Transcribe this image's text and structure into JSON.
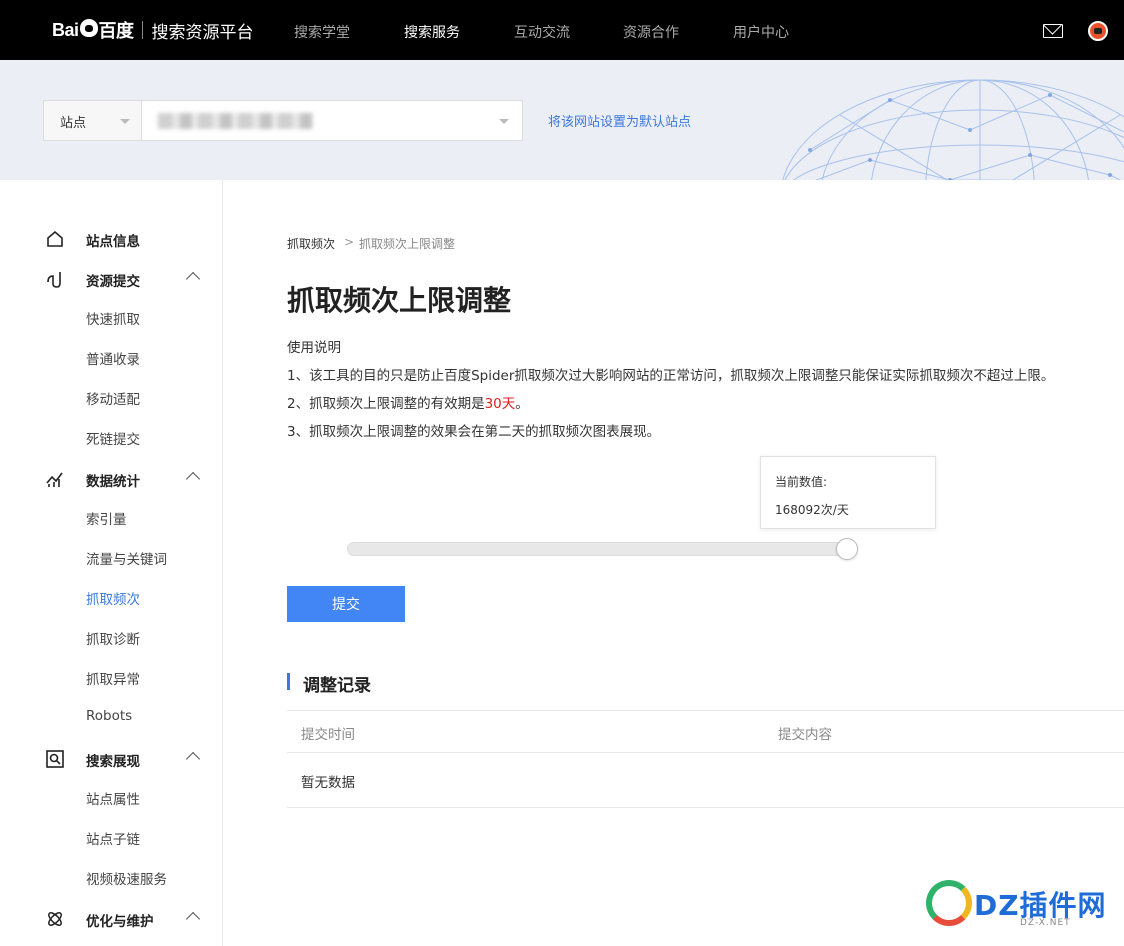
{
  "topbar": {
    "logo_brand": "Bai",
    "logo_du": "百度",
    "platform": "搜索资源平台",
    "nav": [
      {
        "label": "搜索学堂",
        "active": false
      },
      {
        "label": "搜索服务",
        "active": true
      },
      {
        "label": "互动交流",
        "active": false
      },
      {
        "label": "资源合作",
        "active": false
      },
      {
        "label": "用户中心",
        "active": false
      }
    ],
    "icons": [
      "mail-icon",
      "avatar"
    ]
  },
  "site_bar": {
    "label": "站点",
    "set_default_link": "将该网站设置为默认站点"
  },
  "sidebar": {
    "sections": [
      {
        "label": "站点信息",
        "icon": "home-icon",
        "items": []
      },
      {
        "label": "资源提交",
        "icon": "submit-icon",
        "items": [
          "快速抓取",
          "普通收录",
          "移动适配",
          "死链提交"
        ]
      },
      {
        "label": "数据统计",
        "icon": "stats-icon",
        "items": [
          "索引量",
          "流量与关键词",
          "抓取频次",
          "抓取诊断",
          "抓取异常",
          "Robots"
        ]
      },
      {
        "label": "搜索展现",
        "icon": "search-display-icon",
        "items": [
          "站点属性",
          "站点子链",
          "视频极速服务"
        ]
      },
      {
        "label": "优化与维护",
        "icon": "optimize-icon",
        "items": []
      }
    ],
    "active_item": "抓取频次"
  },
  "breadcrumb": {
    "parent": "抓取频次",
    "separator": ">",
    "current": "抓取频次上限调整"
  },
  "main": {
    "title": "抓取频次上限调整",
    "usage_heading": "使用说明",
    "desc1": "1、该工具的目的只是防止百度Spider抓取频次过大影响网站的正常访问，抓取频次上限调整只能保证实际抓取频次不超过上限。",
    "desc2_prefix": "2、抓取频次上限调整的有效期是",
    "desc2_highlight": "30天",
    "desc2_suffix": "。",
    "desc3": "3、抓取频次上限调整的效果会在第二天的抓取频次图表展现。"
  },
  "slider": {
    "tooltip_label": "当前数值:",
    "tooltip_value": "168092次/天",
    "position_fraction": 1.0
  },
  "submit_button": "提交",
  "records": {
    "title": "调整记录",
    "columns": [
      "提交时间",
      "提交内容"
    ],
    "empty_text": "暂无数据"
  },
  "watermark": {
    "text": "DZ插件网",
    "sub": "DZ-X.NET"
  },
  "colors": {
    "accent": "#4285f4",
    "link": "#3a78e0",
    "highlight_red": "#e02020",
    "topbar": "#000000"
  }
}
